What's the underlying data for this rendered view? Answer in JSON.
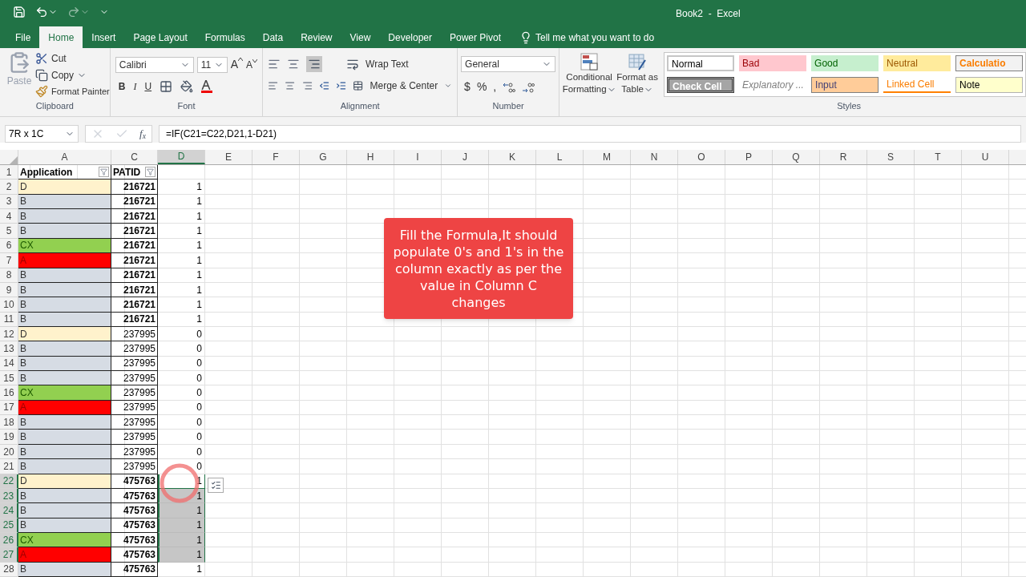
{
  "window": {
    "title": "Book2  -  Excel"
  },
  "tabs": [
    {
      "label": "File",
      "selected": false
    },
    {
      "label": "Home",
      "selected": true
    },
    {
      "label": "Insert",
      "selected": false
    },
    {
      "label": "Page Layout",
      "selected": false
    },
    {
      "label": "Formulas",
      "selected": false
    },
    {
      "label": "Data",
      "selected": false
    },
    {
      "label": "Review",
      "selected": false
    },
    {
      "label": "View",
      "selected": false
    },
    {
      "label": "Developer",
      "selected": false
    },
    {
      "label": "Power Pivot",
      "selected": false
    }
  ],
  "tell_me": "Tell me what you want to do",
  "ribbon": {
    "clipboard": {
      "label": "Clipboard",
      "paste": "Paste",
      "cut": "Cut",
      "copy": "Copy",
      "format_painter": "Format Painter"
    },
    "font": {
      "label": "Font",
      "name": "Calibri",
      "size": "11",
      "grow": "A",
      "shrink": "A",
      "bold": "B",
      "italic": "I",
      "underline": "U"
    },
    "alignment": {
      "label": "Alignment",
      "wrap_text": "Wrap Text",
      "merge": "Merge & Center"
    },
    "number": {
      "label": "Number",
      "format": "General",
      "currency": "$",
      "percent": "%",
      "comma": ","
    },
    "styles": {
      "label": "Styles",
      "conditional": [
        "Conditional",
        "Formatting"
      ],
      "format_table": [
        "Format as",
        "Table"
      ],
      "gallery": [
        {
          "label": "Normal",
          "kind": "normal"
        },
        {
          "label": "Bad",
          "kind": "bad"
        },
        {
          "label": "Good",
          "kind": "good"
        },
        {
          "label": "Neutral",
          "kind": "neutral"
        },
        {
          "label": "Calculatio",
          "kind": "calculation"
        },
        {
          "label": "Check Cell",
          "kind": "check"
        },
        {
          "label": "Explanatory ...",
          "kind": "explanatory"
        },
        {
          "label": "Input",
          "kind": "input"
        },
        {
          "label": "Linked Cell",
          "kind": "linked"
        },
        {
          "label": "Note",
          "kind": "note"
        }
      ]
    }
  },
  "formula_bar": {
    "name_box": "7R x 1C",
    "function": "f$_{x}$",
    "formula": "=IF(C21=C22,D21,1-D21)"
  },
  "columns": [
    {
      "label": "A",
      "selected": false
    },
    {
      "label": "C",
      "selected": false
    },
    {
      "label": "D",
      "selected": true
    },
    {
      "label": "E",
      "selected": false
    },
    {
      "label": "F",
      "selected": false
    },
    {
      "label": "G",
      "selected": false
    },
    {
      "label": "H",
      "selected": false
    },
    {
      "label": "I",
      "selected": false
    },
    {
      "label": "J",
      "selected": false
    },
    {
      "label": "K",
      "selected": false
    },
    {
      "label": "L",
      "selected": false
    },
    {
      "label": "M",
      "selected": false
    },
    {
      "label": "N",
      "selected": false
    },
    {
      "label": "O",
      "selected": false
    },
    {
      "label": "P",
      "selected": false
    },
    {
      "label": "Q",
      "selected": false
    },
    {
      "label": "R",
      "selected": false
    },
    {
      "label": "S",
      "selected": false
    },
    {
      "label": "T",
      "selected": false
    },
    {
      "label": "U",
      "selected": false
    }
  ],
  "header_row": {
    "num": "1",
    "application": "Application",
    "patid": "PATID"
  },
  "rows": [
    {
      "num": "2",
      "app": "D",
      "color": "#fff2cc",
      "patid": "216721",
      "bold": true,
      "value": "1",
      "selected": false,
      "active": false
    },
    {
      "num": "3",
      "app": "B",
      "color": "#d6dce4",
      "patid": "216721",
      "bold": true,
      "value": "1",
      "selected": false,
      "active": false
    },
    {
      "num": "4",
      "app": "B",
      "color": "#d6dce4",
      "patid": "216721",
      "bold": true,
      "value": "1",
      "selected": false,
      "active": false
    },
    {
      "num": "5",
      "app": "B",
      "color": "#d6dce4",
      "patid": "216721",
      "bold": true,
      "value": "1",
      "selected": false,
      "active": false
    },
    {
      "num": "6",
      "app": "CX",
      "color": "#92d050",
      "patid": "216721",
      "bold": true,
      "value": "1",
      "selected": false,
      "active": false
    },
    {
      "num": "7",
      "app": "A",
      "color": "#ff0000",
      "patid": "216721",
      "bold": true,
      "value": "1",
      "selected": false,
      "active": false
    },
    {
      "num": "8",
      "app": "B",
      "color": "#d6dce4",
      "patid": "216721",
      "bold": true,
      "value": "1",
      "selected": false,
      "active": false
    },
    {
      "num": "9",
      "app": "B",
      "color": "#d6dce4",
      "patid": "216721",
      "bold": true,
      "value": "1",
      "selected": false,
      "active": false
    },
    {
      "num": "10",
      "app": "B",
      "color": "#d6dce4",
      "patid": "216721",
      "bold": true,
      "value": "1",
      "selected": false,
      "active": false
    },
    {
      "num": "11",
      "app": "B",
      "color": "#d6dce4",
      "patid": "216721",
      "bold": true,
      "value": "1",
      "selected": false,
      "active": false
    },
    {
      "num": "12",
      "app": "D",
      "color": "#fff2cc",
      "patid": "237995",
      "bold": false,
      "value": "0",
      "selected": false,
      "active": false
    },
    {
      "num": "13",
      "app": "B",
      "color": "#d6dce4",
      "patid": "237995",
      "bold": false,
      "value": "0",
      "selected": false,
      "active": false
    },
    {
      "num": "14",
      "app": "B",
      "color": "#d6dce4",
      "patid": "237995",
      "bold": false,
      "value": "0",
      "selected": false,
      "active": false
    },
    {
      "num": "15",
      "app": "B",
      "color": "#d6dce4",
      "patid": "237995",
      "bold": false,
      "value": "0",
      "selected": false,
      "active": false
    },
    {
      "num": "16",
      "app": "CX",
      "color": "#92d050",
      "patid": "237995",
      "bold": false,
      "value": "0",
      "selected": false,
      "active": false
    },
    {
      "num": "17",
      "app": "A",
      "color": "#ff0000",
      "patid": "237995",
      "bold": false,
      "value": "0",
      "selected": false,
      "active": false
    },
    {
      "num": "18",
      "app": "B",
      "color": "#d6dce4",
      "patid": "237995",
      "bold": false,
      "value": "0",
      "selected": false,
      "active": false
    },
    {
      "num": "19",
      "app": "B",
      "color": "#d6dce4",
      "patid": "237995",
      "bold": false,
      "value": "0",
      "selected": false,
      "active": false
    },
    {
      "num": "20",
      "app": "B",
      "color": "#d6dce4",
      "patid": "237995",
      "bold": false,
      "value": "0",
      "selected": false,
      "active": false
    },
    {
      "num": "21",
      "app": "B",
      "color": "#d6dce4",
      "patid": "237995",
      "bold": false,
      "value": "0",
      "selected": false,
      "active": false
    },
    {
      "num": "22",
      "app": "D",
      "color": "#fff2cc",
      "patid": "475763",
      "bold": true,
      "value": "1",
      "selected": true,
      "active": true
    },
    {
      "num": "23",
      "app": "B",
      "color": "#d6dce4",
      "patid": "475763",
      "bold": true,
      "value": "1",
      "selected": true,
      "active": false
    },
    {
      "num": "24",
      "app": "B",
      "color": "#d6dce4",
      "patid": "475763",
      "bold": true,
      "value": "1",
      "selected": true,
      "active": false
    },
    {
      "num": "25",
      "app": "B",
      "color": "#d6dce4",
      "patid": "475763",
      "bold": true,
      "value": "1",
      "selected": true,
      "active": false
    },
    {
      "num": "26",
      "app": "CX",
      "color": "#92d050",
      "patid": "475763",
      "bold": true,
      "value": "1",
      "selected": true,
      "active": false
    },
    {
      "num": "27",
      "app": "A",
      "color": "#ff0000",
      "patid": "475763",
      "bold": true,
      "value": "1",
      "selected": true,
      "active": false
    },
    {
      "num": "28",
      "app": "B",
      "color": "#d6dce4",
      "patid": "475763",
      "bold": true,
      "value": "1",
      "selected": false,
      "active": false
    }
  ],
  "callout": "Fill the Formula,It should populate 0's and 1's in the column exactly as per the value in Column C changes"
}
